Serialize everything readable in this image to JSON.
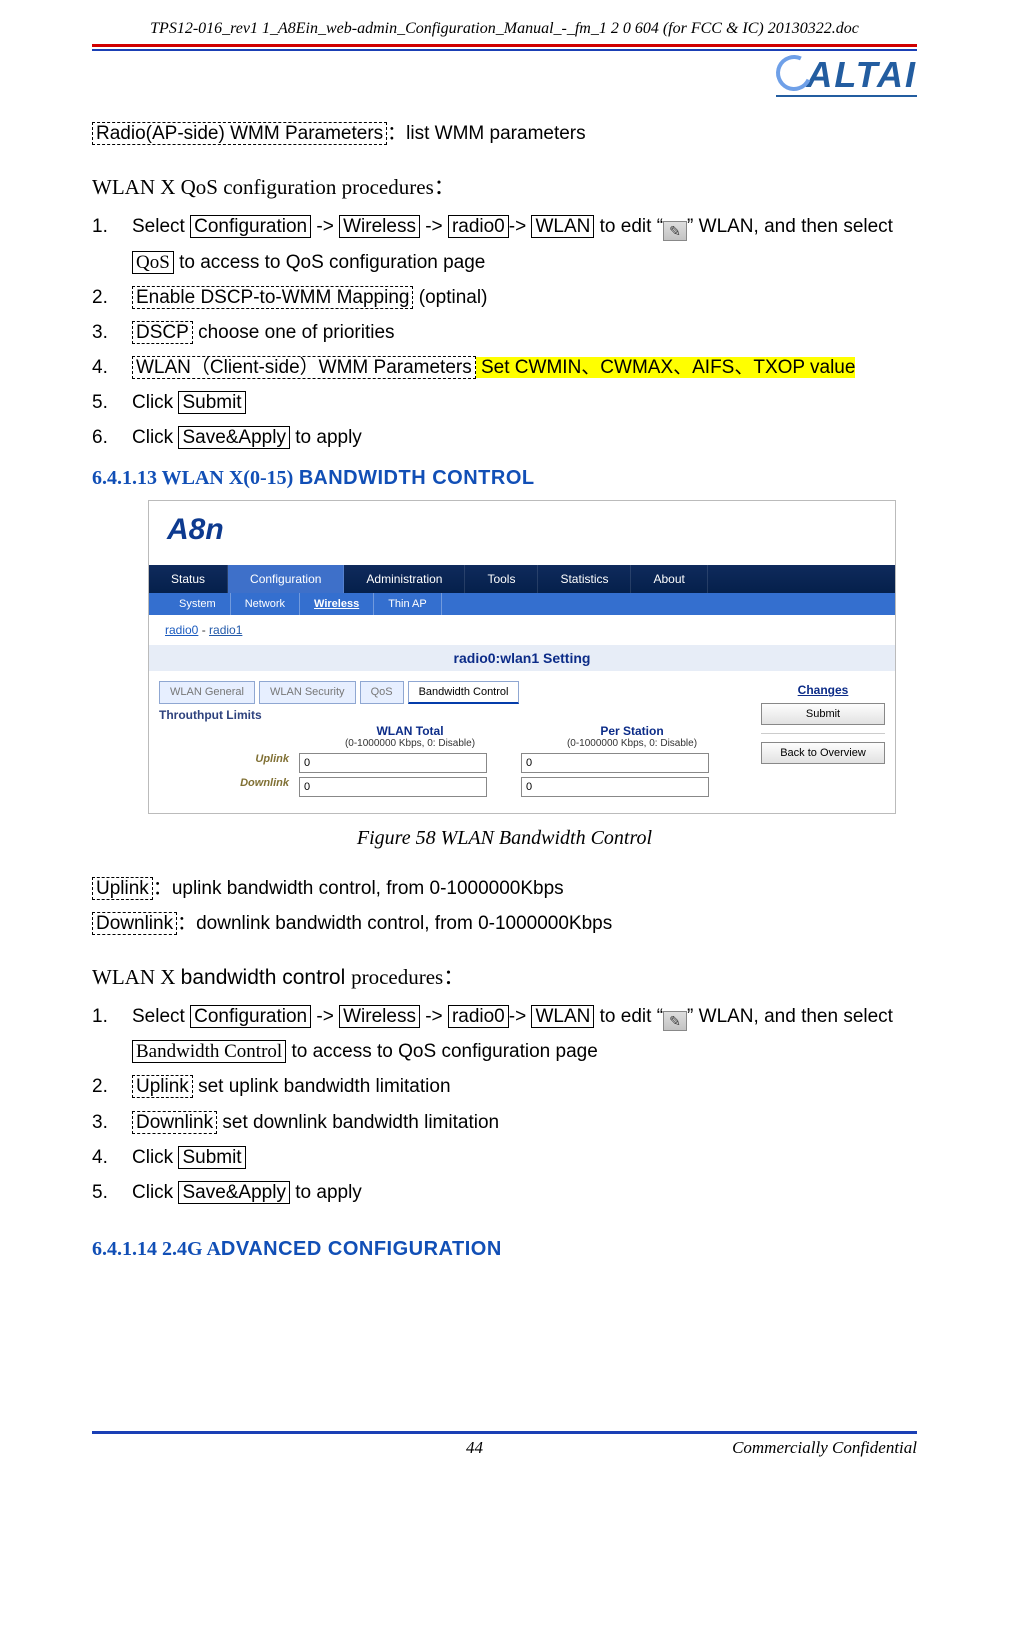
{
  "doc_header": "TPS12-016_rev1 1_A8Ein_web-admin_Configuration_Manual_-_fm_1 2 0 604 (for FCC & IC) 20130322.doc",
  "logo_text": "ALTAI",
  "line_radio_wmm_label": "Radio(AP-side) WMM Parameters",
  "line_radio_wmm_desc": "：list WMM parameters",
  "qos_proc_title": "WLAN X QoS configuration procedures",
  "colon_full": "：",
  "nav_words": {
    "select": "Select ",
    "configuration": "Configuration",
    "arrow": " -> ",
    "wireless": "Wireless",
    "radio0": "radio0",
    "arrow2": "-> ",
    "wlan": "WLAN",
    "to_edit": " to edit  ",
    "quoteL": "“",
    "quoteR": "”",
    "wlan_after": "  WLAN, and then select ",
    "qos_link": "QoS",
    "to_access": " to access to QoS configuration page"
  },
  "qos_steps": {
    "s2_box": "Enable DSCP-to-WMM Mapping",
    "s2_after": " (optinal)",
    "s3_box": "DSCP",
    "s3_after": " choose one of priorities",
    "s4_box": "WLAN（Client-side）WMM Parameters",
    "s4_hl": " Set CWMIN、CWMAX、AIFS、TXOP value",
    "click": "Click ",
    "submit_btn": "Submit",
    "saveapply_btn": "Save&Apply",
    "to_apply": " to apply"
  },
  "heading_6_4_1_13_num": "6.4.1.13",
  "heading_6_4_1_13_a": " WLAN X(0-15)",
  "heading_6_4_1_13_b": "   B",
  "heading_6_4_1_13_c": "ANDWIDTH CONTROL",
  "shot": {
    "logo": "A8n",
    "tabs": [
      "Status",
      "Configuration",
      "Administration",
      "Tools",
      "Statistics",
      "About"
    ],
    "active_tab": 1,
    "subnav": [
      "System",
      "Network",
      "Wireless",
      "Thin AP"
    ],
    "active_subnav": 2,
    "bc_radio0": "radio0",
    "bc_sep": "   -   ",
    "bc_radio1": "radio1",
    "radio_title": "radio0:wlan1 Setting",
    "subtabs": [
      "WLAN General",
      "WLAN Security",
      "QoS",
      "Bandwidth Control"
    ],
    "active_subtab": 3,
    "throughput": "Throuthput Limits",
    "col_total": "WLAN Total",
    "col_per": "Per Station",
    "range_note": "(0-1000000 Kbps, 0: Disable)",
    "row_up": "Uplink",
    "row_dn": "Downlink",
    "val_up_total": "0",
    "val_up_per": "0",
    "val_dn_total": "0",
    "val_dn_per": "0",
    "changes": "Changes",
    "submit": "Submit",
    "back": "Back to Overview"
  },
  "fig58": "Figure 58 WLAN Bandwidth Control",
  "uplink_box": "Uplink",
  "uplink_desc": "：uplink bandwidth control, from 0-1000000Kbps",
  "downlink_box": "Downlink",
  "downlink_desc": "：downlink bandwidth control, from 0-1000000Kbps",
  "bw_proc_title_a": "WLAN X ",
  "bw_proc_title_b": "bandwidth control ",
  "bw_proc_title_c": "procedures",
  "bw_step1_tail": "Bandwidth Control",
  "bw_step1_access": " to access to QoS configuration page",
  "bw_step2_box": "Uplink",
  "bw_step2_after": " set uplink bandwidth limitation",
  "bw_step3_box": "Downlink",
  "bw_step3_after": " set downlink bandwidth limitation",
  "heading_6_4_1_14_num": "6.4.1.14",
  "heading_6_4_1_14_a": " 2.4G A",
  "heading_6_4_1_14_b": "DVANCED CONFIGURATION",
  "page_num": "44",
  "footer_conf": "Commercially Confidential",
  "chart_data": {
    "type": "table",
    "title": "Throuthput Limits",
    "columns": [
      "",
      "WLAN Total",
      "Per Station"
    ],
    "note": "(0-1000000 Kbps, 0: Disable)",
    "rows": [
      {
        "label": "Uplink",
        "wlan_total": 0,
        "per_station": 0
      },
      {
        "label": "Downlink",
        "wlan_total": 0,
        "per_station": 0
      }
    ]
  }
}
